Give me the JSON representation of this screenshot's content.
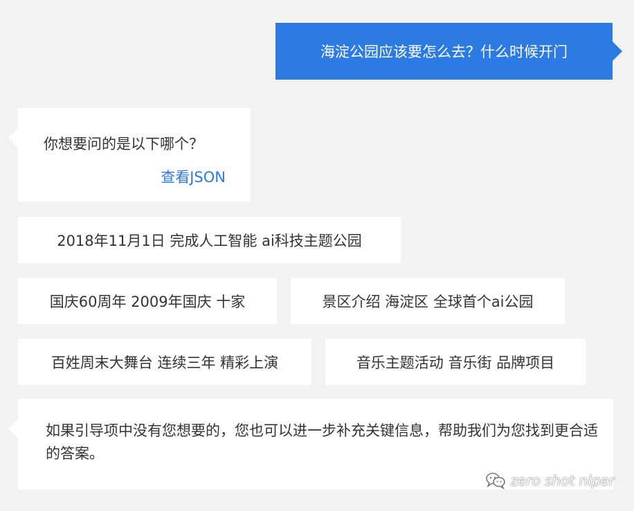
{
  "user_message": {
    "text": "海淀公园应该要怎么去？什么时候开门"
  },
  "clarify": {
    "question": "你想要问的是以下哪个？",
    "link_label": "查看JSON"
  },
  "options": [
    "2018年11月1日 完成人工智能 ai科技主题公园",
    "国庆60周年 2009年国庆 十家",
    "景区介绍 海淀区 全球首个ai公园",
    "百姓周末大舞台 连续三年 精彩上演",
    "音乐主题活动 音乐街 品牌项目"
  ],
  "hint": {
    "text": "如果引导项中没有您想要的，您也可以进一步补充关键信息，帮助我们为您找到更合适的答案。"
  },
  "watermark": {
    "text": "zero shot nlper",
    "icon": "wechat-icon"
  },
  "colors": {
    "background": "#f2f2f3",
    "user_bubble": "#2c7be5",
    "link": "#2c7be5",
    "bot_bubble": "#ffffff"
  }
}
